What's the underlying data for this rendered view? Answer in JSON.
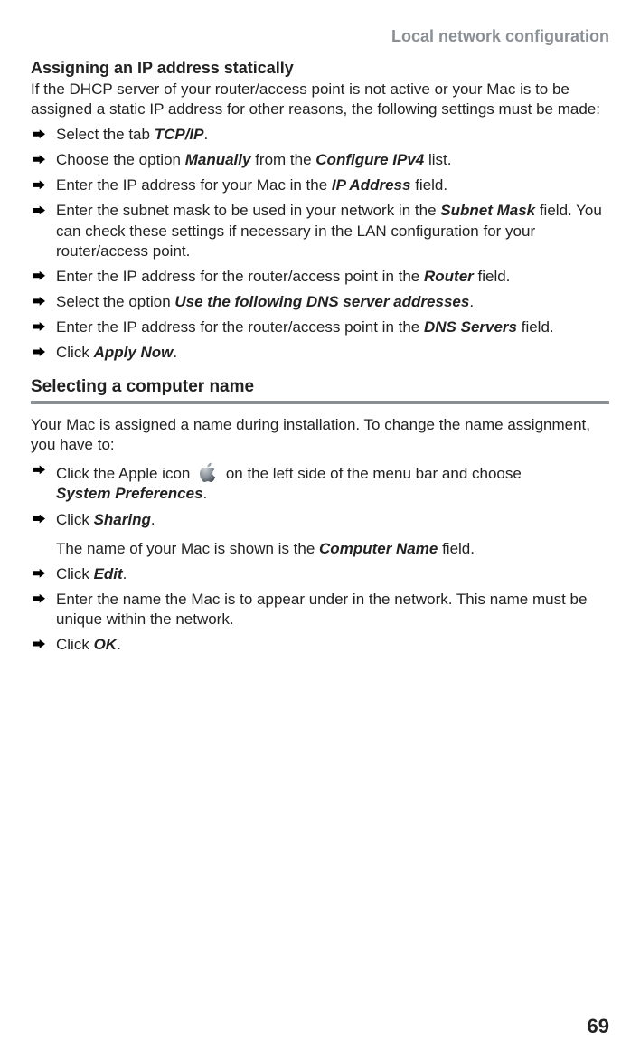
{
  "running_head": "Local network configuration",
  "section1_title": "Assigning an IP address statically",
  "section1_intro": "If the DHCP server of your router/access point is not active or your Mac is to be assigned a static IP address for other reasons, the following settings must be made:",
  "s1_steps": {
    "a_pre": "Select the tab ",
    "a_b": "TCP/IP",
    "a_post": ".",
    "b_pre": "Choose the option ",
    "b_b1": "Manually",
    "b_mid": " from the ",
    "b_b2": "Configure IPv4",
    "b_post": " list.",
    "c_pre": "Enter the IP address for your Mac in the ",
    "c_b": "IP Address",
    "c_post": " field.",
    "d_pre": "Enter the subnet mask to be used in your network in the ",
    "d_b": "Subnet Mask",
    "d_post": " field. You can check these settings if necessary in the LAN configuration for your router/access point.",
    "e_pre": "Enter the IP address for the router/access point in the ",
    "e_b": "Router",
    "e_post": " field.",
    "f_pre": "Select the option ",
    "f_b": "Use the following DNS server addresses",
    "f_post": ".",
    "g_pre": "Enter the IP address for the router/access point in the ",
    "g_b": "DNS Servers",
    "g_post": " field.",
    "h_pre": "Click ",
    "h_b": "Apply Now",
    "h_post": "."
  },
  "section2_title": "Selecting a computer name",
  "section2_intro": "Your Mac is assigned a name during installation. To change the name assignment, you have to:",
  "s2_steps": {
    "a_pre": "Click the Apple icon ",
    "a_post": " on the left side of the menu bar and choose ",
    "a_b": "System Preferences",
    "a_end": ".",
    "b_pre": "Click ",
    "b_b": "Sharing",
    "b_post": ".",
    "b_sub_pre": "The name of your Mac is shown is the ",
    "b_sub_b": "Computer Name",
    "b_sub_post": " field.",
    "c_pre": "Click ",
    "c_b": "Edit",
    "c_post": ".",
    "d_text": "Enter the name the Mac is to appear under in the network. This name must be unique within the network.",
    "e_pre": "Click ",
    "e_b": "OK",
    "e_post": "."
  },
  "page_number": "69"
}
